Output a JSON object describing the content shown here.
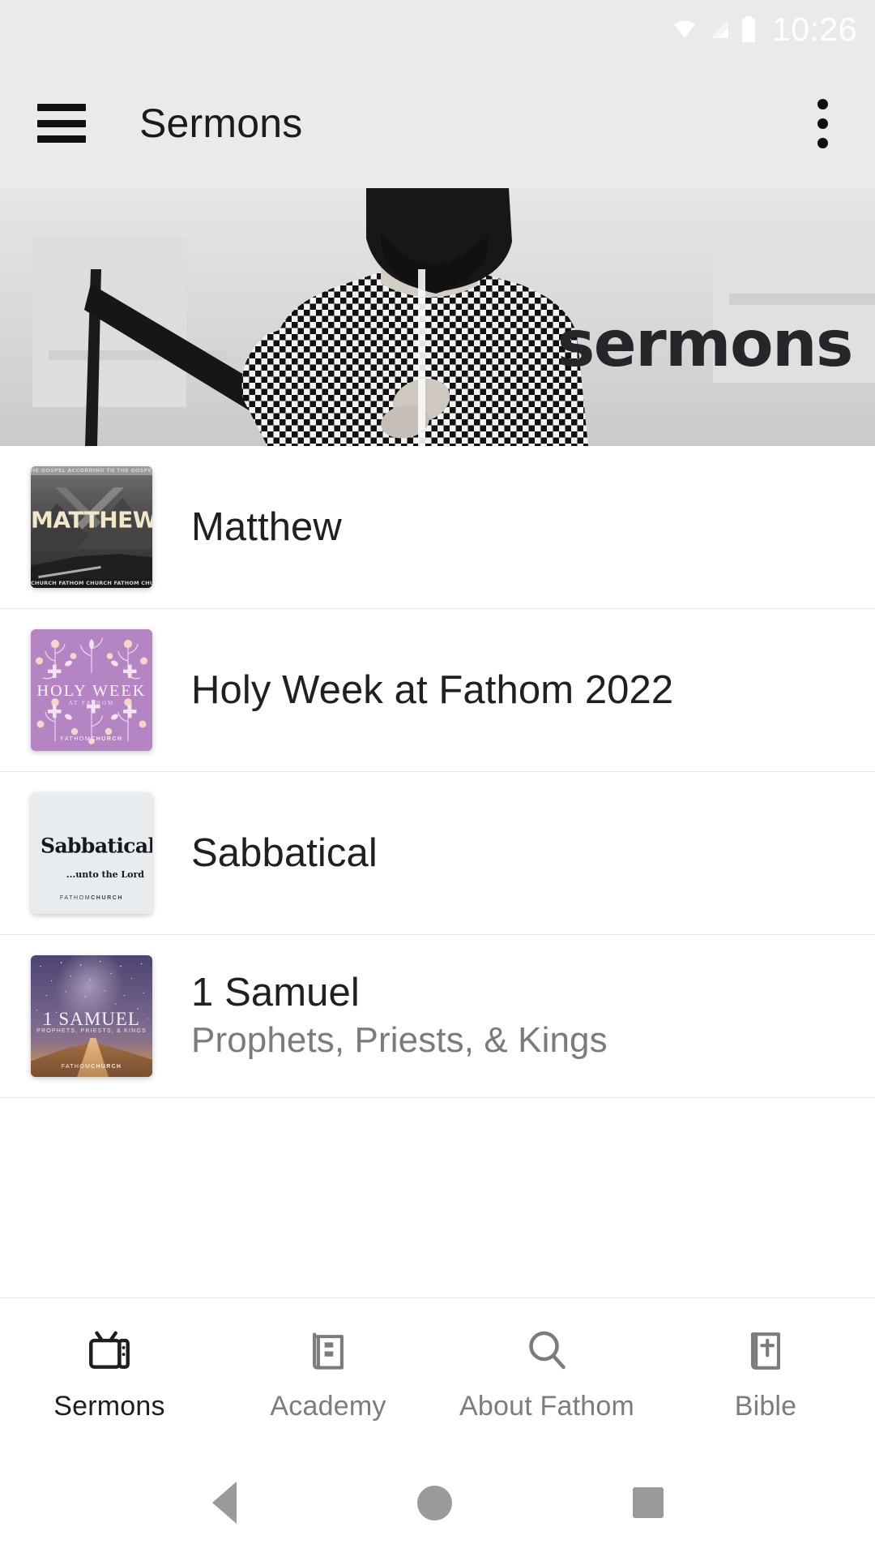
{
  "status_bar": {
    "time": "10:26",
    "icons": [
      "wifi-icon",
      "cell-signal-icon",
      "battery-icon"
    ]
  },
  "app_bar": {
    "menu_icon": "hamburger-menu-icon",
    "title": "Sermons",
    "overflow_icon": "more-vertical-icon"
  },
  "hero": {
    "label": "sermons",
    "description": "grayscale photo of man in checkered shirt with microphone stand"
  },
  "series": [
    {
      "title": "Matthew",
      "subtitle": "",
      "thumb": {
        "style": "matthew",
        "top_strip": "HE GOSPEL ACCORDING TO THE GOSPEL ACCORDING T",
        "word": "MATTHEW",
        "bottom_strip": "CHURCH FATHOM CHURCH FATHOM CHURCH FATHOM",
        "colors": {
          "bg": "#4a4a4a",
          "word": "#f2e7c9"
        }
      }
    },
    {
      "title": "Holy Week at Fathom 2022",
      "subtitle": "",
      "thumb": {
        "style": "holy-week",
        "title": "HOLY WEEK",
        "sub": "AT FATHOM",
        "foot_light": "FATHOM",
        "foot_bold": "CHURCH",
        "colors": {
          "bg": "#b484c3",
          "art": "#f5e7f2"
        }
      }
    },
    {
      "title": "Sabbatical",
      "subtitle": "",
      "thumb": {
        "style": "sabbatical",
        "title": "Sabbatical",
        "sub": "...unto the Lord",
        "foot_light": "FATHOM",
        "foot_bold": "CHURCH",
        "colors": {
          "bg": "#e8ecee",
          "text": "#15181c"
        }
      }
    },
    {
      "title": "1 Samuel",
      "subtitle": "Prophets, Priests, & Kings",
      "thumb": {
        "style": "samuel",
        "title": "1 SAMUEL",
        "sub": "PROPHETS, PRIESTS, & KINGS",
        "foot_light": "FATHOM",
        "foot_bold": "CHURCH",
        "colors": {
          "sky": "#6a5b86",
          "sand": "#c9995f"
        }
      }
    }
  ],
  "tabs": [
    {
      "label": "Sermons",
      "icon": "television-icon",
      "active": true
    },
    {
      "label": "Academy",
      "icon": "open-book-icon",
      "active": false
    },
    {
      "label": "About Fathom",
      "icon": "magnifying-glass-icon",
      "active": false
    },
    {
      "label": "Bible",
      "icon": "bible-book-icon",
      "active": false
    }
  ],
  "android_nav": {
    "back": "back-triangle-icon",
    "home": "home-circle-icon",
    "recents": "recents-square-icon"
  },
  "colors": {
    "app_bar_bg": "#e9eaec",
    "page_bg": "#ffffff",
    "title_text": "#202020",
    "subtitle_text": "#7b7b7b",
    "tab_inactive": "#7c7c7c",
    "tab_active": "#1e1e1e",
    "divider": "#e6e6e6",
    "nav_icon": "#9a9a9a"
  }
}
